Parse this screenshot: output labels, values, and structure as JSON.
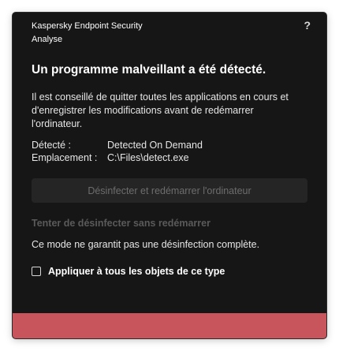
{
  "app": {
    "title": "Kaspersky Endpoint Security",
    "subtitle": "Analyse",
    "help_label": "?"
  },
  "alert": {
    "headline": "Un programme malveillant a été détecté.",
    "advice": "Il est conseillé de quitter toutes les applications en cours et d'enregistrer les modifications avant de redémarrer l'ordinateur."
  },
  "details": {
    "detected_label": "Détecté :",
    "detected_value": "Detected On Demand",
    "location_label": "Emplacement :",
    "location_value": "C:\\Files\\detect.exe"
  },
  "actions": {
    "primary_label": "Désinfecter et redémarrer l'ordinateur",
    "alt_label": "Tenter de désinfecter sans redémarrer",
    "note": "Ce mode ne garantit pas une désinfection complète.",
    "apply_all_label": "Appliquer à tous les objets de ce type",
    "apply_all_checked": false
  },
  "colors": {
    "window_bg": "#161616",
    "status_bar": "#c8545c",
    "disabled_text": "#5a5a5a"
  }
}
